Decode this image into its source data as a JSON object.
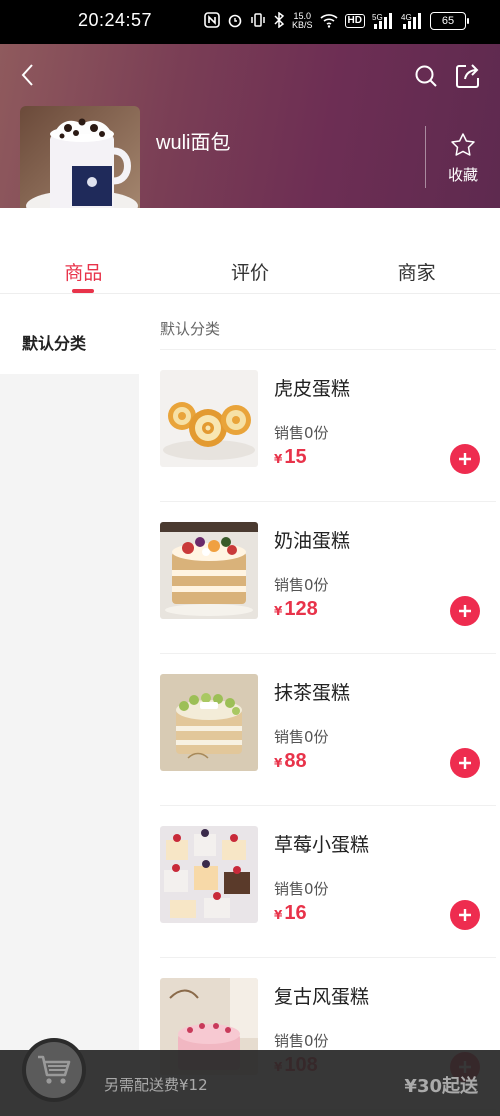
{
  "status_bar": {
    "time": "20:24:57",
    "network_speed": "15.0\nKB/S",
    "hd": "HD",
    "sig1": "5G",
    "sig2": "4G",
    "battery": "65"
  },
  "shop": {
    "name": "wuli面包",
    "favorite_label": "收藏"
  },
  "tabs": [
    {
      "label": "商品",
      "active": true
    },
    {
      "label": "评价",
      "active": false
    },
    {
      "label": "商家",
      "active": false
    }
  ],
  "sidebar": {
    "categories": [
      "默认分类"
    ]
  },
  "list": {
    "section_title": "默认分类",
    "items": [
      {
        "name": "虎皮蛋糕",
        "sold": "销售0份",
        "currency": "¥",
        "price": "15"
      },
      {
        "name": "奶油蛋糕",
        "sold": "销售0份",
        "currency": "¥",
        "price": "128"
      },
      {
        "name": "抹茶蛋糕",
        "sold": "销售0份",
        "currency": "¥",
        "price": "88"
      },
      {
        "name": "草莓小蛋糕",
        "sold": "销售0份",
        "currency": "¥",
        "price": "16"
      },
      {
        "name": "复古风蛋糕",
        "sold": "销售0份",
        "currency": "¥",
        "price": "108"
      }
    ]
  },
  "cart": {
    "delivery_fee": "另需配送费¥12",
    "min_order": "¥30起送"
  },
  "colors": {
    "accent": "#e8334a",
    "banner_start": "#8f5a5d",
    "banner_end": "#5e2a4f"
  }
}
